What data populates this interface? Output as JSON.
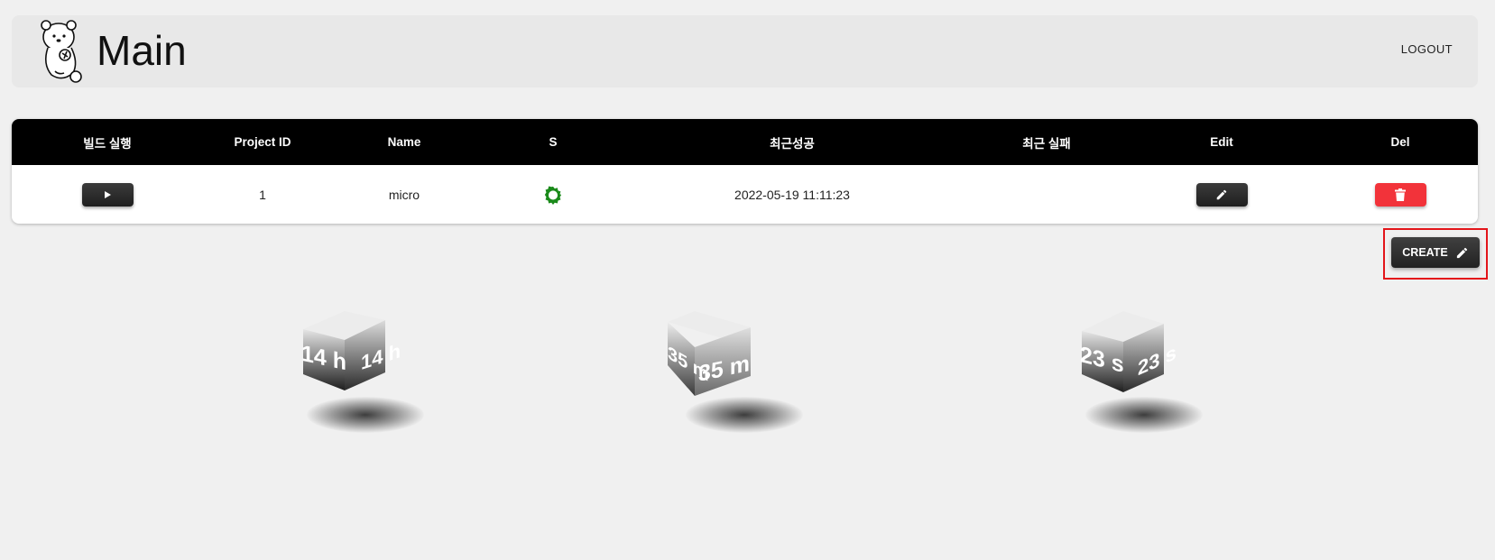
{
  "header": {
    "title": "Main",
    "logout_label": "LOGOUT"
  },
  "table": {
    "columns": [
      "빌드 실행",
      "Project ID",
      "Name",
      "S",
      "최근성공",
      "최근 실패",
      "Edit",
      "Del"
    ],
    "rows": [
      {
        "project_id": "1",
        "name": "micro",
        "status_icon": "gear-success-icon",
        "last_success": "2022-05-19 11:11:23",
        "last_failure": ""
      }
    ]
  },
  "create_button": {
    "label": "CREATE"
  },
  "cubes": [
    {
      "front": "14 h",
      "side": "14 h"
    },
    {
      "front": "35 m",
      "side": "35 m"
    },
    {
      "front": "23 s",
      "side": "23 s"
    }
  ],
  "colors": {
    "header_bg": "#e8e8e8",
    "table_head_bg": "#000000",
    "delete_red": "#f2333a",
    "status_green": "#1a8a1a",
    "highlight_red": "#e3151a"
  }
}
